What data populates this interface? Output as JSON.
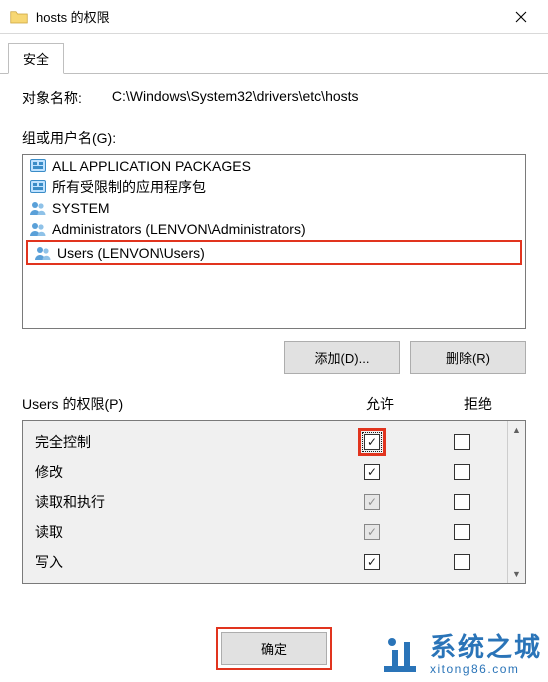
{
  "window": {
    "title": "hosts 的权限",
    "close_icon": "close"
  },
  "tab_label": "安全",
  "object_label": "对象名称:",
  "object_path": "C:\\Windows\\System32\\drivers\\etc\\hosts",
  "group_label": "组或用户名(G):",
  "principals": [
    {
      "name": "ALL APPLICATION PACKAGES",
      "icon": "pkg"
    },
    {
      "name": "所有受限制的应用程序包",
      "icon": "pkg"
    },
    {
      "name": "SYSTEM",
      "icon": "users"
    },
    {
      "name": "Administrators (LENVON\\Administrators)",
      "icon": "users"
    },
    {
      "name": "Users (LENVON\\Users)",
      "icon": "users"
    }
  ],
  "selected_principal_index": 4,
  "add_label": "添加(D)...",
  "remove_label": "删除(R)",
  "perm_title": "Users 的权限(P)",
  "allow_label": "允许",
  "deny_label": "拒绝",
  "permissions": [
    {
      "name": "完全控制",
      "allow": true,
      "deny": false,
      "allow_dim": false,
      "highlighted": true
    },
    {
      "name": "修改",
      "allow": true,
      "deny": false,
      "allow_dim": false,
      "highlighted": false
    },
    {
      "name": "读取和执行",
      "allow": true,
      "deny": false,
      "allow_dim": true,
      "highlighted": false
    },
    {
      "name": "读取",
      "allow": true,
      "deny": false,
      "allow_dim": true,
      "highlighted": false
    },
    {
      "name": "写入",
      "allow": true,
      "deny": false,
      "allow_dim": false,
      "highlighted": false
    }
  ],
  "ok_label": "确定",
  "watermark": {
    "cn": "系统之城",
    "en": "xitong86.com"
  }
}
